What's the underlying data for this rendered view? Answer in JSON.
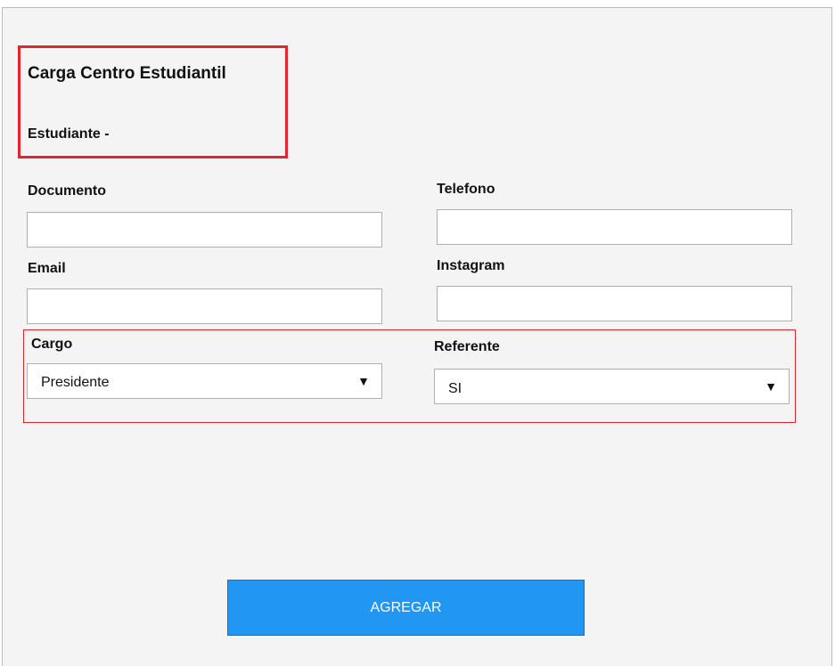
{
  "header": {
    "title": "Carga Centro Estudiantil",
    "subtitle": "Estudiante -"
  },
  "form": {
    "documento": {
      "label": "Documento",
      "value": "",
      "placeholder": ""
    },
    "telefono": {
      "label": "Telefono",
      "value": "",
      "placeholder": ""
    },
    "email": {
      "label": "Email",
      "value": "",
      "placeholder": ""
    },
    "instagram": {
      "label": "Instagram",
      "value": "",
      "placeholder": ""
    },
    "cargo": {
      "label": "Cargo",
      "selected": "Presidente"
    },
    "referente": {
      "label": "Referente",
      "selected": "SI"
    },
    "submit_label": "AGREGAR"
  },
  "icons": {
    "dropdown_caret": "caret-down-icon"
  },
  "colors": {
    "highlight": "#e32431",
    "button_bg": "#2196f3",
    "button_border": "#2e7d32",
    "panel_bg": "#f4f4f4"
  }
}
